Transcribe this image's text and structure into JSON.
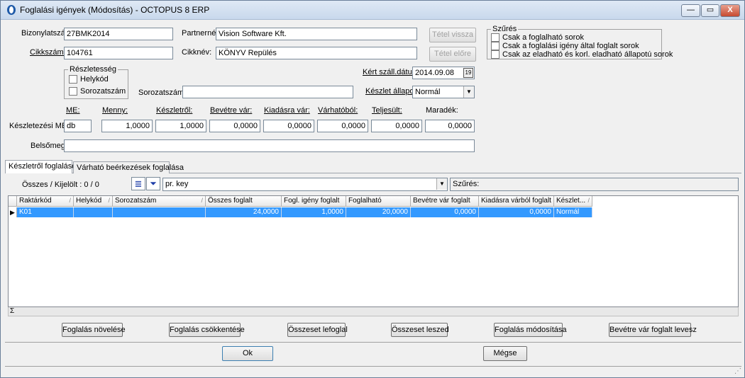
{
  "window": {
    "title": "Foglalási igények (Módosítás)   -   OCTOPUS 8 ERP",
    "min_label": "—",
    "max_label": "▭",
    "close_label": "X"
  },
  "form": {
    "bizonylatszam_label": "Bizonylatszám:",
    "bizonylatszam_value": "27BMK2014",
    "cikkszam_label": "Cikkszám:",
    "cikkszam_value": "104761",
    "partnernev_label": "Partnernév:",
    "partnernev_value": "Vision Software Kft.",
    "cikknev_label": "Cikknév:",
    "cikknev_value": "KÖNYV Repülés",
    "tetel_vissza_label": "Tétel vissza",
    "tetel_elore_label": "Tétel előre"
  },
  "szures_group": {
    "title": "Szűrés",
    "options": [
      "Csak a foglalható sorok",
      "Csak a foglalási igény által foglalt sorok",
      "Csak az eladható és korl. eladható állapotú sorok"
    ]
  },
  "reszletesseg": {
    "title": "Részletesség",
    "helykod_label": "Helykód",
    "sorozatszam_label": "Sorozatszám"
  },
  "sorozatszam_field_label": "Sorozatszám:",
  "kert_szall_datum_label": "Kért száll.dátum:",
  "kert_szall_datum_value": "2014.09.08",
  "calendar_icon_text": "19",
  "keszlet_allapot_label": "Készlet állapot:",
  "keszlet_allapot_value": "Normál",
  "quantities": {
    "row_label": "Készletezési ME",
    "headers": [
      "ME:",
      "Menny:",
      "Készletről:",
      "Bevétre vár:",
      "Kiadásra vár:",
      "Várhatóból:",
      "Teljesült:",
      "Maradék:"
    ],
    "values": [
      "db",
      "1,0000",
      "1,0000",
      "0,0000",
      "0,0000",
      "0,0000",
      "0,0000",
      "0,0000"
    ]
  },
  "belsomegj_label": "Belsőmegj:",
  "tabs": [
    "Készletről foglalások",
    "Várható beérkezések foglalása"
  ],
  "toolbar": {
    "count_text": "Összes / Kijelölt :   0 / 0",
    "combo_value": "pr. key",
    "szures_label": "Szűrés:"
  },
  "grid": {
    "columns": [
      "Raktárkód",
      "Helykód",
      "Sorozatszám",
      "Összes foglalt",
      "Fogl. igény foglalt",
      "Foglalható",
      "Bevétre vár foglalt",
      "Kiadásra várból foglalt",
      "Készlet..."
    ],
    "rows": [
      [
        "K01",
        "",
        "",
        "24,0000",
        "1,0000",
        "20,0000",
        "0,0000",
        "0,0000",
        "Normál"
      ]
    ],
    "selected_row": 0,
    "selection_color": "#3399ff",
    "sum_symbol": "Σ"
  },
  "actions": {
    "foglalas_novelese": "Foglalás növelése",
    "foglalas_csokkentese": "Foglalás csökkentése",
    "osszeset_lefoglal": "Összeset lefoglal",
    "osszeset_leszed": "Összeset leszed",
    "foglalas_modositasa": "Foglalás módosítása",
    "bevetre_var_foglalt_levesz": "Bevétre vár foglalt levesz"
  },
  "dialog": {
    "ok_label": "Ok",
    "megse_label": "Mégse"
  }
}
